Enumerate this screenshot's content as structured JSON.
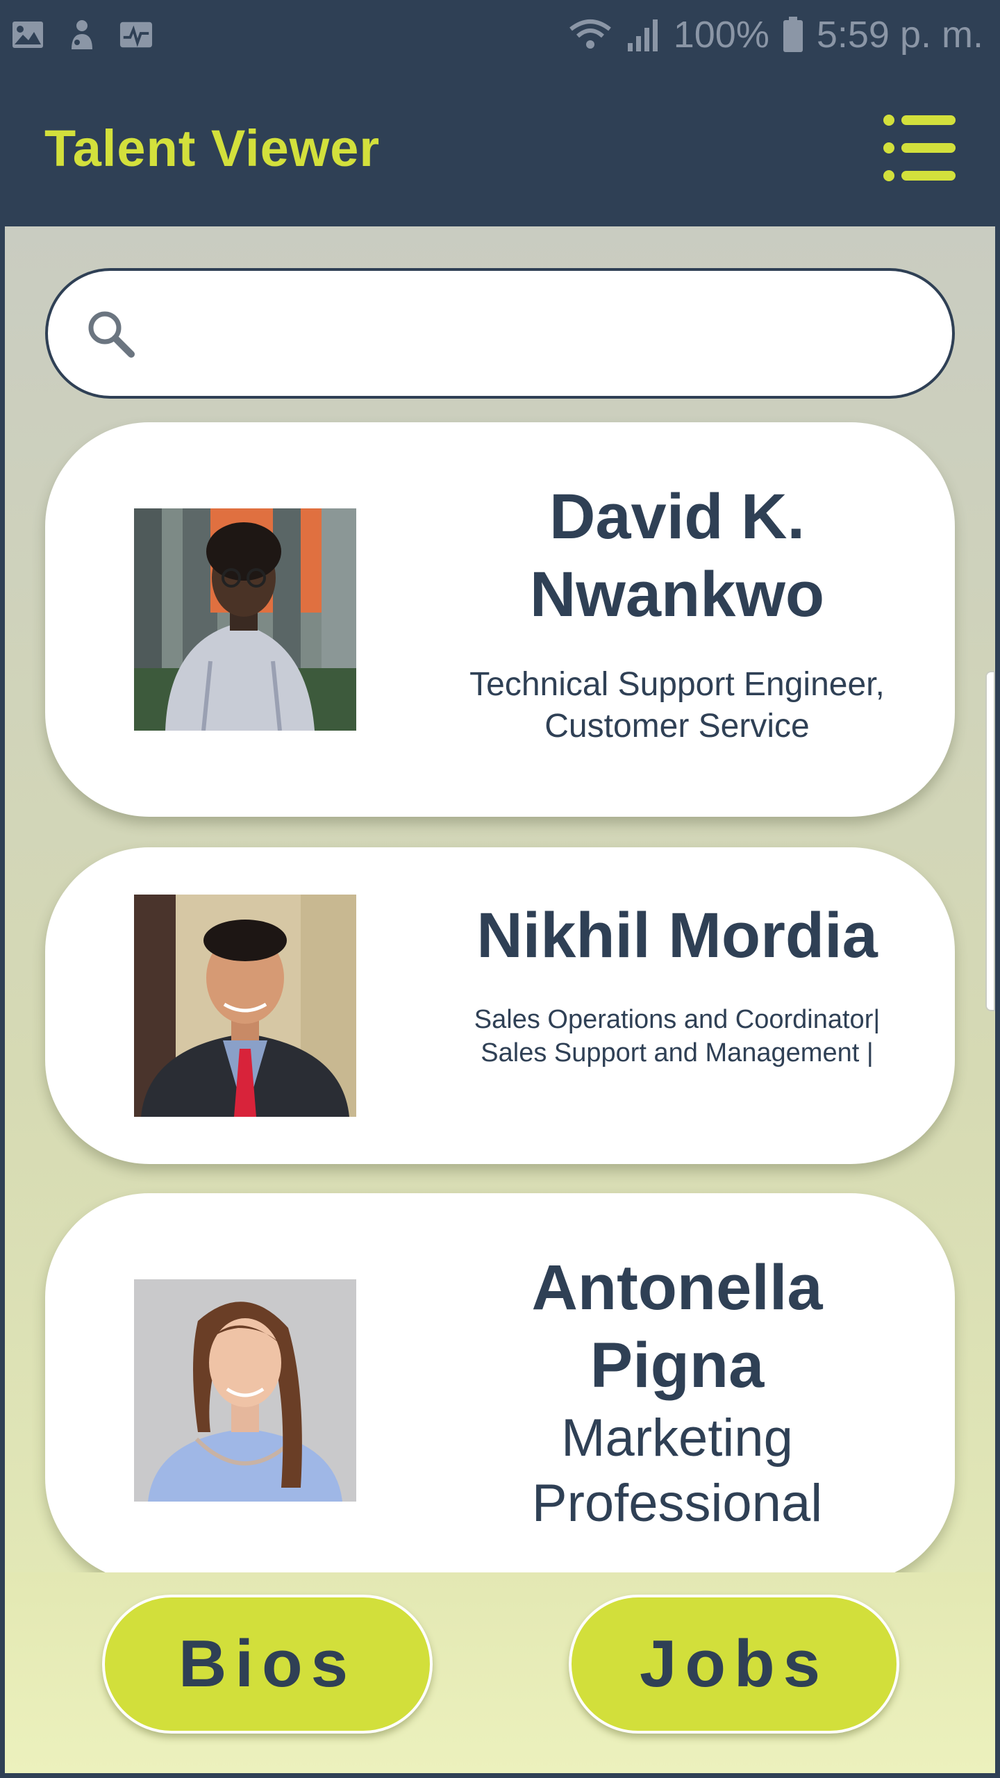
{
  "status_bar": {
    "battery": "100%",
    "time": "5:59 p. m."
  },
  "app_bar": {
    "title": "Talent Viewer"
  },
  "search": {
    "placeholder": "",
    "value": ""
  },
  "profiles": [
    {
      "name": "David K. Nwankwo",
      "role": "Technical Support Engineer, Customer Service"
    },
    {
      "name": "Nikhil Mordia",
      "role": "Sales Operations and Coordinator| Sales Support and Management |"
    },
    {
      "name": "Antonella Pigna",
      "role": "Marketing Professional"
    }
  ],
  "bottom_nav": {
    "bios_label": "Bios",
    "jobs_label": "Jobs"
  },
  "colors": {
    "primary_dark": "#2f4055",
    "accent": "#d3e03c"
  }
}
